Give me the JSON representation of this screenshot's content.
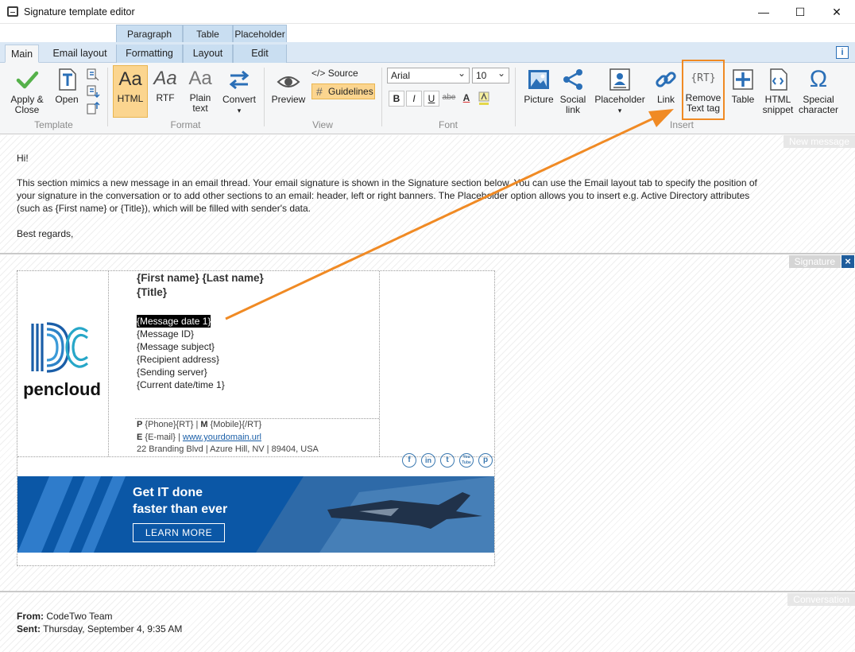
{
  "window": {
    "title": "Signature template editor",
    "minimize": "—",
    "maximize": "☐",
    "close": "✕"
  },
  "context_tabs": [
    "Paragraph",
    "Table",
    "Placeholder"
  ],
  "tabs": [
    "Main",
    "Email layout",
    "Formatting",
    "Layout",
    "Edit"
  ],
  "info_icon": "i",
  "ribbon": {
    "template": {
      "label": "Template",
      "apply_close": [
        "Apply &",
        "Close"
      ],
      "open": "Open"
    },
    "format": {
      "label": "Format",
      "html": "HTML",
      "rtf": "RTF",
      "plain_text": [
        "Plain",
        "text"
      ],
      "convert": "Convert",
      "aa_glyph": "Aa"
    },
    "view": {
      "label": "View",
      "preview": "Preview",
      "source": "Source",
      "source_glyph": "</>",
      "guidelines": "Guidelines"
    },
    "font": {
      "label": "Font",
      "family": "Arial",
      "size": "10",
      "bold": "B",
      "italic": "I",
      "underline": "U",
      "strike": "abe",
      "color": "A"
    },
    "insert": {
      "label": "Insert",
      "picture": "Picture",
      "social_link": [
        "Social",
        "link"
      ],
      "placeholder": "Placeholder",
      "link": "Link",
      "remove_text_tag": [
        "Remove",
        "Text tag"
      ],
      "rt_glyph": "{RT}",
      "table": "Table",
      "html_snippet": [
        "HTML",
        "snippet"
      ],
      "special_character": [
        "Special",
        "character"
      ],
      "omega_glyph": "Ω"
    }
  },
  "new_message": {
    "label": "New message",
    "greeting": "Hi!",
    "body_line1": "This section mimics a new message in an email thread. Your email signature is shown in the Signature section below. You can use the Email layout tab to specify the position of",
    "body_line2": "your signature in the conversation or to add other sections to an email: header, left or right banners. The Placeholder option allows you to insert e.g. Active Directory attributes",
    "body_line3": "(such as {First name} or {Title}), which will be filled with sender's data.",
    "closing": "Best regards,"
  },
  "signature": {
    "label": "Signature",
    "close_icon": "×",
    "logo_text": "pencloud",
    "name": "{First name} {Last name}",
    "title": "{Title}",
    "placeholders": [
      "{Message date 1}",
      "{Message ID}",
      "{Message subject}",
      "{Recipient address}",
      "{Sending server}",
      "{Current date/time 1}"
    ],
    "contact": {
      "p_label": "P",
      "phone": "{Phone}{RT}",
      "sep1": "|",
      "m_label": "M",
      "mobile": "{Mobile}{/RT}",
      "e_label": "E",
      "email": "{E-mail}",
      "sep2": "|",
      "website": "www.yourdomain.url",
      "address": "22 Branding Blvd | Azure Hill, NV | 89404, USA"
    },
    "social_icons": [
      "f",
      "in",
      "t",
      "You Tube",
      "p"
    ],
    "banner": {
      "line1": "Get IT done",
      "line2": "faster than ever",
      "button": "LEARN MORE"
    }
  },
  "conversation": {
    "label": "Conversation",
    "from_label": "From:",
    "from_value": "CodeTwo Team",
    "sent_label": "Sent:",
    "sent_value": "Thursday, September 4, 9:35 AM"
  },
  "colors": {
    "accent_orange": "#f08a24",
    "ribbon_selected": "#fbd58f",
    "ribbon_bg": "#f5f6f7",
    "brand_blue": "#0b57a6"
  }
}
